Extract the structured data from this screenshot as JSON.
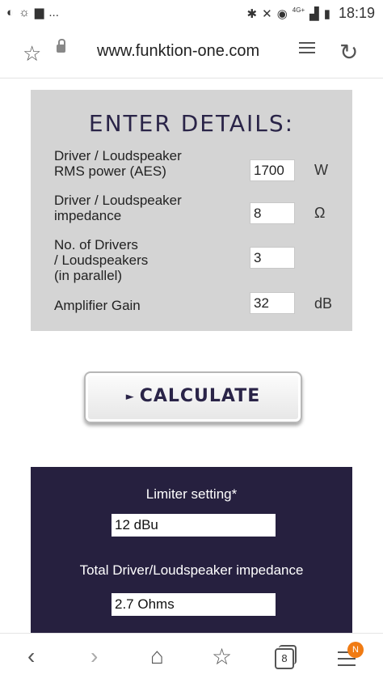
{
  "status_bar": {
    "left_icons": [
      "whatsapp-icon",
      "sun-icon",
      "message-icon",
      "more-icon"
    ],
    "more": "...",
    "network": "4G+",
    "time": "18:19"
  },
  "browser": {
    "url": "www.funktion-one.com"
  },
  "details": {
    "title": "ENTER DETAILS:",
    "rows": [
      {
        "label_lines": [
          "Driver / Loudspeaker",
          "RMS power (AES)"
        ],
        "value": "1700",
        "unit": "W"
      },
      {
        "label_lines": [
          "Driver / Loudspeaker",
          "impedance"
        ],
        "value": "8",
        "unit": "Ω"
      },
      {
        "label_lines": [
          "No. of Drivers",
          "/ Loudspeakers",
          "(in parallel)"
        ],
        "value": "3",
        "unit": ""
      },
      {
        "label_lines": [
          "Amplifier Gain"
        ],
        "value": "32",
        "unit": "dB"
      }
    ]
  },
  "calculate": {
    "arrow": "►",
    "label": "CALCULATE"
  },
  "results": {
    "limiter_label": "Limiter setting*",
    "limiter_value": "12 dBu",
    "impedance_label": "Total Driver/Loudspeaker impedance",
    "impedance_value": "2.7 Ohms"
  },
  "nav": {
    "tabs_count": "8",
    "badge": "N"
  }
}
